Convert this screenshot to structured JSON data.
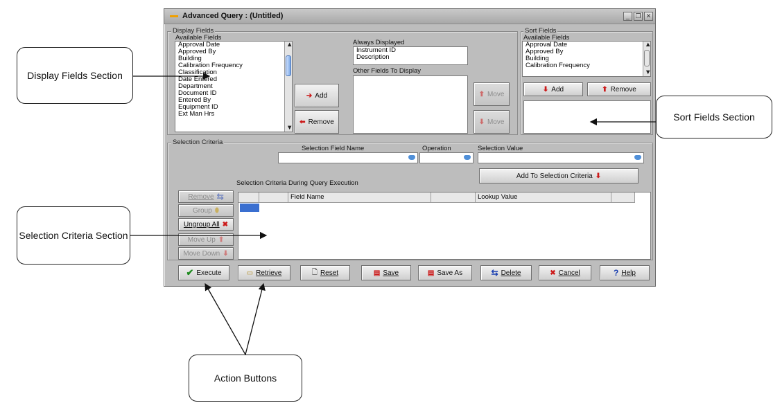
{
  "window": {
    "title": "Advanced Query : (Untitled)",
    "controls": [
      "minimize-icon",
      "restore-icon",
      "close-icon"
    ]
  },
  "display_fields": {
    "group_label": "Display Fields",
    "available_label": "Available Fields",
    "available_items": [
      "Approval Date",
      "Approved By",
      "Building",
      "Calibration Frequency",
      "Classification",
      "Date Entered",
      "Department",
      "Document ID",
      "Entered By",
      "Equipment ID",
      "Ext Man Hrs"
    ],
    "always_label": "Always Displayed",
    "always_items": [
      "Instrument ID",
      "Description"
    ],
    "other_label": "Other Fields To Display",
    "add_label": "Add",
    "remove_label": "Remove",
    "move_up_label": "Move",
    "move_down_label": "Move"
  },
  "sort_fields": {
    "group_label": "Sort Fields",
    "available_label": "Available Fields",
    "available_items": [
      "Approval Date",
      "Approved By",
      "Building",
      "Calibration Frequency"
    ],
    "add_label": "Add",
    "remove_label": "Remove"
  },
  "selection_criteria": {
    "group_label": "Selection Criteria",
    "field_name_label": "Selection Field Name",
    "operation_label": "Operation",
    "value_label": "Selection Value",
    "field_name_value": "",
    "operation_value": "",
    "value_value": "",
    "add_button": "Add To Selection Criteria",
    "during_label": "Selection Criteria During Query Execution",
    "grid_columns": [
      "Field Name",
      "Lookup Value"
    ],
    "side_buttons": {
      "remove": "Remove",
      "group": "Group",
      "ungroup": "Ungroup All",
      "move_up": "Move Up",
      "move_down": "Move Down"
    }
  },
  "action_buttons": {
    "execute": "Execute",
    "retrieve": "Retrieve",
    "reset": "Reset",
    "save": "Save",
    "save_as": "Save As",
    "delete": "Delete",
    "cancel": "Cancel",
    "help": "Help"
  },
  "callouts": {
    "display_fields": "Display Fields Section",
    "sort_fields": "Sort Fields Section",
    "selection_criteria": "Selection Criteria Section",
    "action_buttons": "Action Buttons"
  },
  "colors": {
    "window_bg": "#bdbdbd",
    "accent_red": "#cc1a1a",
    "accent_blue": "#4f8fd8",
    "selected_cell": "#3a6fd0"
  }
}
